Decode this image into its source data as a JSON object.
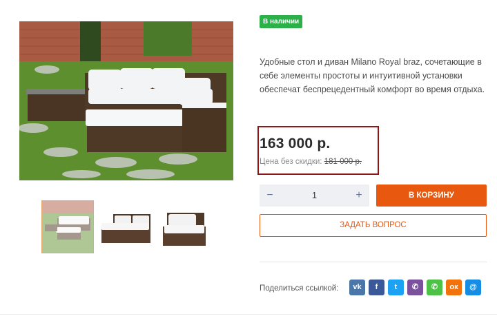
{
  "product": {
    "availability_badge": "В наличии",
    "description": "Удобные стол и диван Milano Royal braz, сочетающие в себе элементы простоты и интуитивной установки обеспечат беспрецедентный комфорт во время отдыха.",
    "price": "163 000 р.",
    "old_price_label": "Цена без скидки:",
    "old_price": "181 000 р."
  },
  "purchase": {
    "quantity": "1",
    "minus_label": "−",
    "plus_label": "+",
    "add_to_cart_label": "В КОРЗИНУ",
    "ask_question_label": "ЗАДАТЬ ВОПРОС"
  },
  "share": {
    "label": "Поделиться ссылкой:",
    "networks": [
      {
        "name": "vk-icon",
        "glyph": "vk",
        "color": "#4a76a8"
      },
      {
        "name": "facebook-icon",
        "glyph": "f",
        "color": "#3b5998"
      },
      {
        "name": "twitter-icon",
        "glyph": "t",
        "color": "#1da1f2"
      },
      {
        "name": "viber-icon",
        "glyph": "✆",
        "color": "#7b519d"
      },
      {
        "name": "whatsapp-icon",
        "glyph": "✆",
        "color": "#4dc247"
      },
      {
        "name": "odnoklassniki-icon",
        "glyph": "ок",
        "color": "#f2720c"
      },
      {
        "name": "moimir-icon",
        "glyph": "@",
        "color": "#168de2"
      }
    ]
  },
  "colors": {
    "badge_green": "#2cb04a",
    "accent_orange": "#e8580e",
    "highlight_border": "#8e1616"
  }
}
